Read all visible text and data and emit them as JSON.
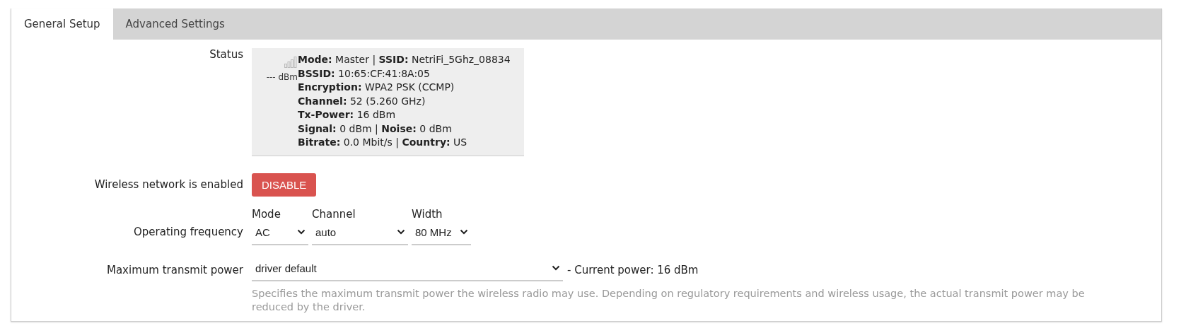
{
  "tabs": [
    {
      "label": "General Setup",
      "selected": true
    },
    {
      "label": "Advanced Settings",
      "selected": false
    }
  ],
  "status": {
    "label": "Status",
    "signal_reading": "--- dBm",
    "lines": [
      "**Mode:** Master | **SSID:** NetriFi_5Ghz_08834",
      "**BSSID:** 10:65:CF:41:8A:05",
      "**Encryption:** WPA2 PSK (CCMP)",
      "**Channel:** 52 (5.260 GHz)",
      "**Tx-Power:** 16 dBm",
      "**Signal:** 0 dBm | **Noise:** 0 dBm",
      "**Bitrate:** 0.0 Mbit/s | **Country:** US"
    ]
  },
  "wireless": {
    "label": "Wireless network is enabled",
    "button": "DISABLE"
  },
  "frequency": {
    "label": "Operating frequency",
    "selects": [
      {
        "label": "Mode",
        "value": "AC"
      },
      {
        "label": "Channel",
        "value": "auto"
      },
      {
        "label": "Width",
        "value": "80 MHz"
      }
    ]
  },
  "power": {
    "label": "Maximum transmit power",
    "value": "driver default",
    "current": "- Current power: 16 dBm",
    "description": "Specifies the maximum transmit power the wireless radio may use. Depending on regulatory requirements and wireless usage, the actual transmit power may be reduced by the driver."
  }
}
